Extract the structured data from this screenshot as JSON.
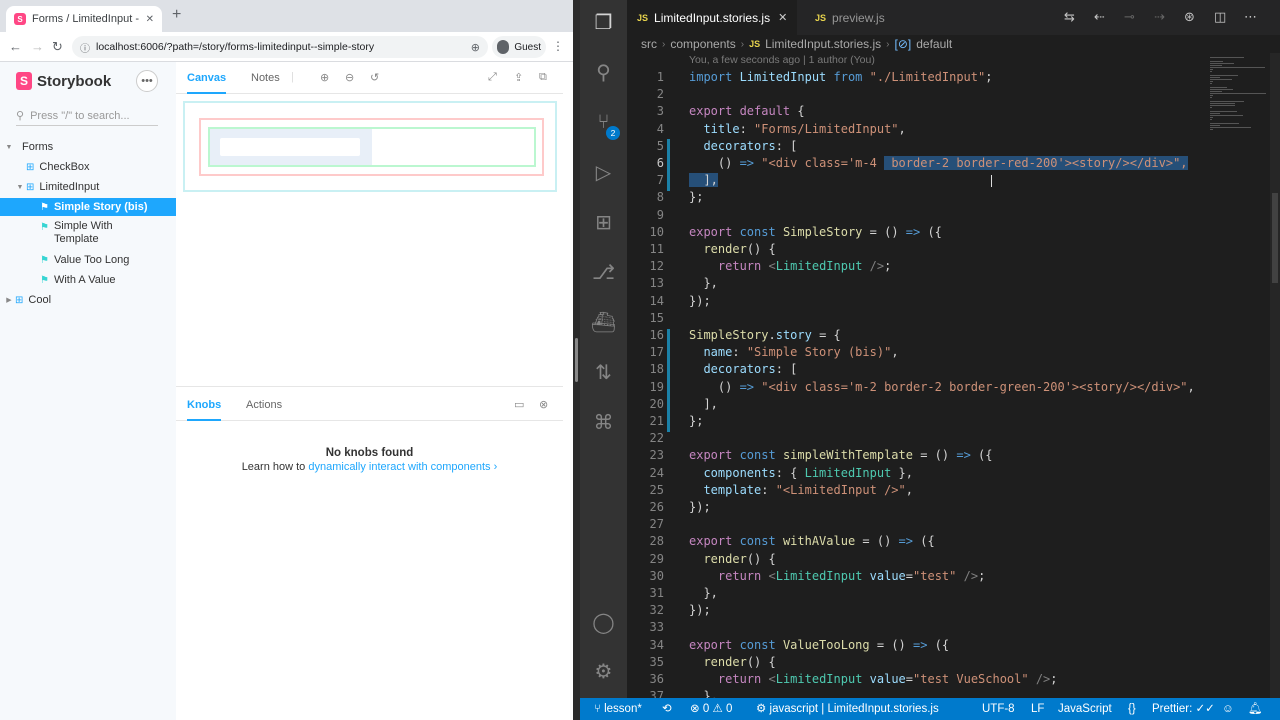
{
  "browser": {
    "tab_title": "Forms / LimitedInput - Simple",
    "tab_favicon": "S",
    "url": "localhost:6006/?path=/story/forms-limitedinput--simple-story",
    "profile_label": "Guest"
  },
  "storybook": {
    "logo_text": "Storybook",
    "search_placeholder": "Press \"/\" to search...",
    "tree": [
      {
        "label": "Forms",
        "level": 0,
        "kind": "folder",
        "expanded": true
      },
      {
        "label": "CheckBox",
        "level": 1,
        "kind": "component",
        "expanded": false
      },
      {
        "label": "LimitedInput",
        "level": 1,
        "kind": "component",
        "expanded": true
      },
      {
        "label": "Simple Story (bis)",
        "level": 2,
        "kind": "story",
        "selected": true
      },
      {
        "label": "Simple With Template",
        "level": 2,
        "kind": "story"
      },
      {
        "label": "Value Too Long",
        "level": 2,
        "kind": "story"
      },
      {
        "label": "With A Value",
        "level": 2,
        "kind": "story"
      },
      {
        "label": "Cool",
        "level": 0,
        "kind": "component",
        "expanded": false
      }
    ],
    "preview_tabs": [
      "Canvas",
      "Notes"
    ],
    "addon_tabs": [
      "Knobs",
      "Actions"
    ],
    "no_knobs_title": "No knobs found",
    "no_knobs_text": "Learn how to",
    "no_knobs_link": "dynamically interact with components",
    "no_knobs_chevron": "›"
  },
  "vscode": {
    "tabs": [
      {
        "label": "LimitedInput.stories.js",
        "badge": "JS",
        "active": true
      },
      {
        "label": "preview.js",
        "badge": "JS",
        "active": false
      }
    ],
    "breadcrumbs": [
      "src",
      "components",
      "LimitedInput.stories.js",
      "default"
    ],
    "blame": "You, a few seconds ago | 1 author (You)",
    "scm_badge": "2",
    "code": [
      [
        [
          "k",
          "import "
        ],
        [
          "v",
          "LimitedInput"
        ],
        [
          "k",
          " from "
        ],
        [
          "s",
          "\"./LimitedInput\""
        ],
        [
          "p",
          ";"
        ]
      ],
      [],
      [
        [
          "kc",
          "export "
        ],
        [
          "kc",
          "default"
        ],
        [
          "p",
          " {"
        ]
      ],
      [
        [
          "p",
          "  "
        ],
        [
          "v",
          "title"
        ],
        [
          "p",
          ": "
        ],
        [
          "s",
          "\"Forms/LimitedInput\""
        ],
        [
          "p",
          ","
        ]
      ],
      [
        [
          "p",
          "  "
        ],
        [
          "v",
          "decorators"
        ],
        [
          "p",
          ": ["
        ]
      ],
      [
        [
          "p",
          "    () "
        ],
        [
          "k",
          "=>"
        ],
        [
          "p",
          " "
        ],
        [
          "s",
          "\"<div class='m-4 "
        ],
        [
          "shl",
          " border-2 border-red-200'><story/></div>\","
        ]
      ],
      [
        [
          "hl",
          "  ],"
        ]
      ],
      [
        [
          "p",
          "};"
        ]
      ],
      [],
      [
        [
          "kc",
          "export "
        ],
        [
          "k",
          "const "
        ],
        [
          "f",
          "SimpleStory"
        ],
        [
          "p",
          " = () "
        ],
        [
          "k",
          "=>"
        ],
        [
          "p",
          " ({"
        ]
      ],
      [
        [
          "p",
          "  "
        ],
        [
          "f",
          "render"
        ],
        [
          "p",
          "() {"
        ]
      ],
      [
        [
          "p",
          "    "
        ],
        [
          "kc",
          "return "
        ],
        [
          "g",
          "<"
        ],
        [
          "c",
          "LimitedInput"
        ],
        [
          "g",
          " />"
        ],
        [
          "p",
          ";"
        ]
      ],
      [
        [
          "p",
          "  },"
        ]
      ],
      [
        [
          "p",
          "});"
        ]
      ],
      [],
      [
        [
          "f",
          "SimpleStory"
        ],
        [
          "p",
          "."
        ],
        [
          "v",
          "story"
        ],
        [
          "p",
          " = {"
        ]
      ],
      [
        [
          "p",
          "  "
        ],
        [
          "v",
          "name"
        ],
        [
          "p",
          ": "
        ],
        [
          "s",
          "\"Simple Story (bis)\""
        ],
        [
          "p",
          ","
        ]
      ],
      [
        [
          "p",
          "  "
        ],
        [
          "v",
          "decorators"
        ],
        [
          "p",
          ": ["
        ]
      ],
      [
        [
          "p",
          "    () "
        ],
        [
          "k",
          "=>"
        ],
        [
          "p",
          " "
        ],
        [
          "s",
          "\"<div class='m-2 border-2 border-green-200'><story/></div>\""
        ],
        [
          "p",
          ","
        ]
      ],
      [
        [
          "p",
          "  ],"
        ]
      ],
      [
        [
          "p",
          "};"
        ]
      ],
      [],
      [
        [
          "kc",
          "export "
        ],
        [
          "k",
          "const "
        ],
        [
          "f",
          "simpleWithTemplate"
        ],
        [
          "p",
          " = () "
        ],
        [
          "k",
          "=>"
        ],
        [
          "p",
          " ({"
        ]
      ],
      [
        [
          "p",
          "  "
        ],
        [
          "v",
          "components"
        ],
        [
          "p",
          ": { "
        ],
        [
          "c",
          "LimitedInput"
        ],
        [
          "p",
          " },"
        ]
      ],
      [
        [
          "p",
          "  "
        ],
        [
          "v",
          "template"
        ],
        [
          "p",
          ": "
        ],
        [
          "s",
          "\"<LimitedInput />\""
        ],
        [
          "p",
          ","
        ]
      ],
      [
        [
          "p",
          "});"
        ]
      ],
      [],
      [
        [
          "kc",
          "export "
        ],
        [
          "k",
          "const "
        ],
        [
          "f",
          "withAValue"
        ],
        [
          "p",
          " = () "
        ],
        [
          "k",
          "=>"
        ],
        [
          "p",
          " ({"
        ]
      ],
      [
        [
          "p",
          "  "
        ],
        [
          "f",
          "render"
        ],
        [
          "p",
          "() {"
        ]
      ],
      [
        [
          "p",
          "    "
        ],
        [
          "kc",
          "return "
        ],
        [
          "g",
          "<"
        ],
        [
          "c",
          "LimitedInput"
        ],
        [
          "v",
          " value"
        ],
        [
          "p",
          "="
        ],
        [
          "s",
          "\"test\""
        ],
        [
          "g",
          " />"
        ],
        [
          "p",
          ";"
        ]
      ],
      [
        [
          "p",
          "  },"
        ]
      ],
      [
        [
          "p",
          "});"
        ]
      ],
      [],
      [
        [
          "kc",
          "export "
        ],
        [
          "k",
          "const "
        ],
        [
          "f",
          "ValueTooLong"
        ],
        [
          "p",
          " = () "
        ],
        [
          "k",
          "=>"
        ],
        [
          "p",
          " ({"
        ]
      ],
      [
        [
          "p",
          "  "
        ],
        [
          "f",
          "render"
        ],
        [
          "p",
          "() {"
        ]
      ],
      [
        [
          "p",
          "    "
        ],
        [
          "kc",
          "return "
        ],
        [
          "g",
          "<"
        ],
        [
          "c",
          "LimitedInput"
        ],
        [
          "v",
          " value"
        ],
        [
          "p",
          "="
        ],
        [
          "s",
          "\"test VueSchool\""
        ],
        [
          "g",
          " />"
        ],
        [
          "p",
          ";"
        ]
      ],
      [
        [
          "p",
          "  },"
        ]
      ]
    ],
    "status": {
      "branch": "lesson*",
      "errors": "0",
      "warnings": "0",
      "language_context": "javascript",
      "file": "LimitedInput.stories.js",
      "encoding": "UTF-8",
      "eol": "LF",
      "language": "JavaScript",
      "prettier": "Prettier:"
    }
  }
}
